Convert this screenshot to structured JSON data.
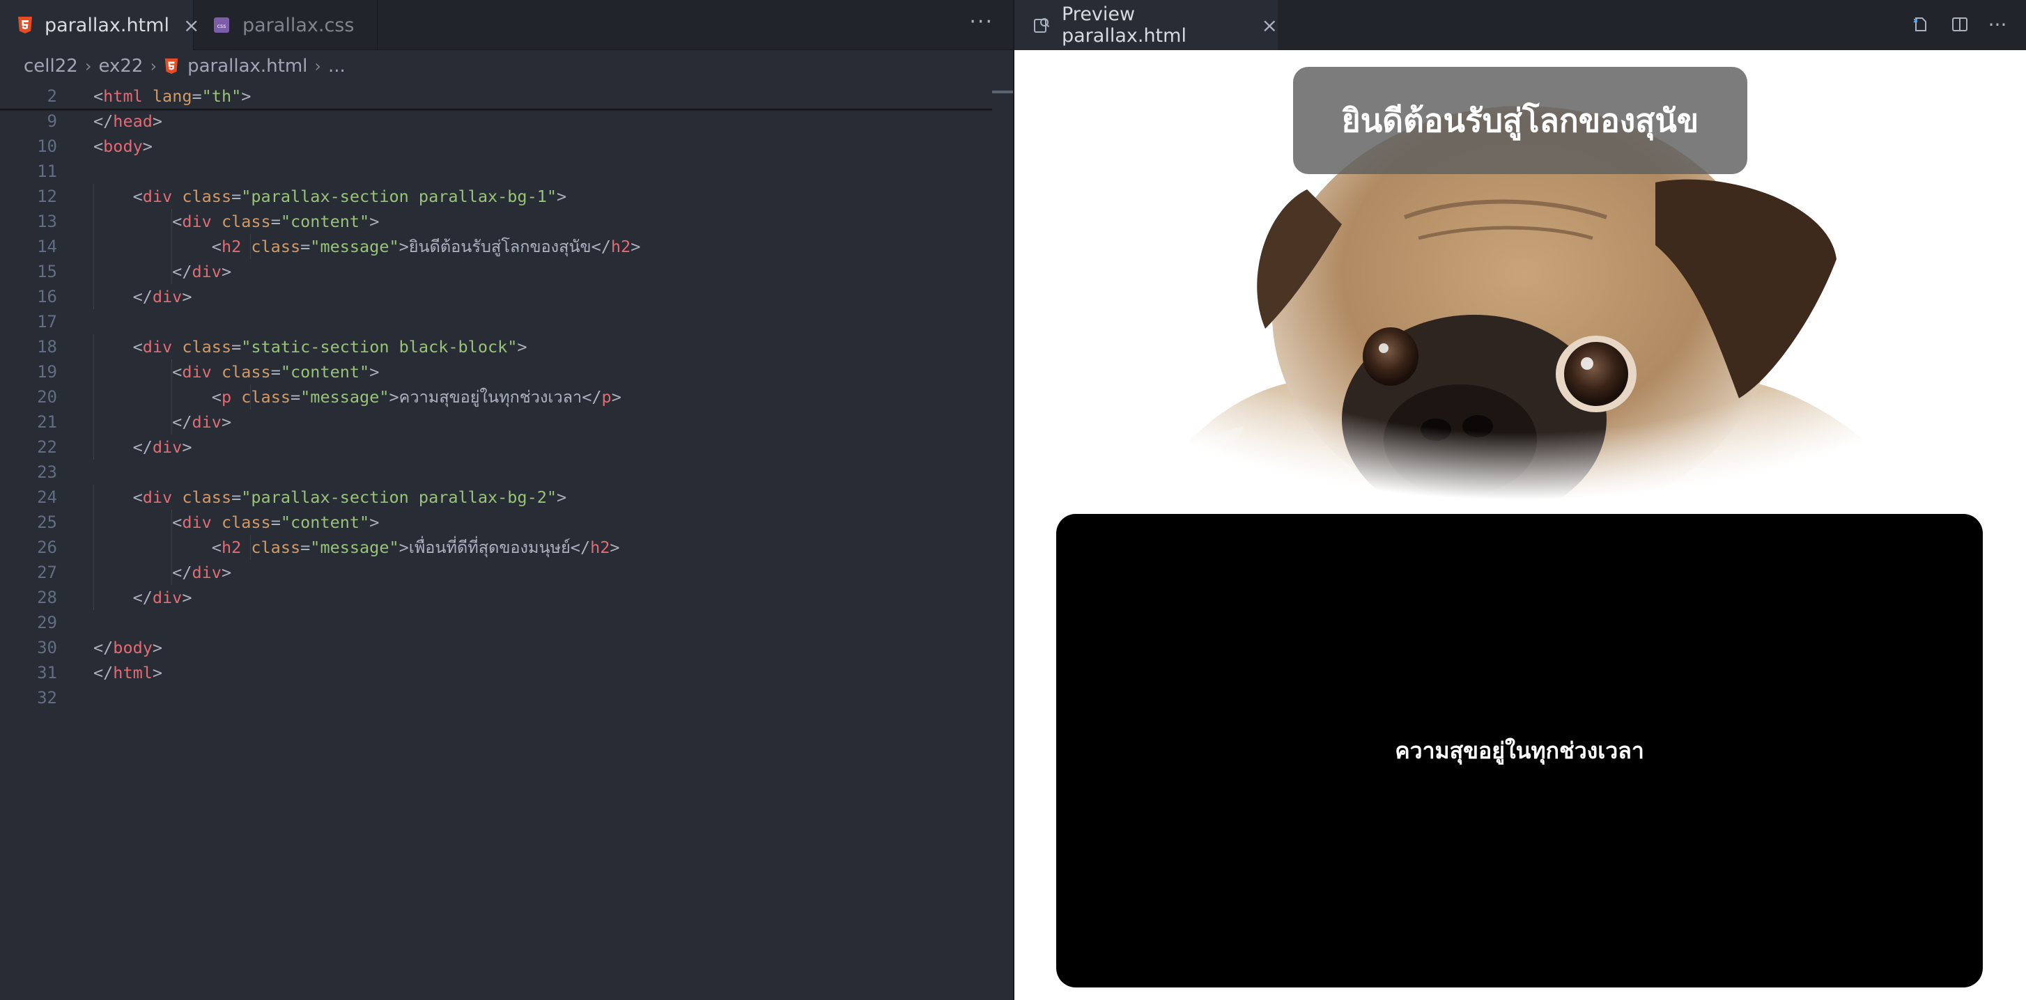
{
  "editor": {
    "tabs": [
      {
        "label": "parallax.html",
        "icon": "html5-file-icon",
        "active": true
      },
      {
        "label": "parallax.css",
        "icon": "css-file-icon",
        "active": false
      }
    ],
    "breadcrumb": {
      "items": [
        "cell22",
        "ex22",
        "parallax.html",
        "..."
      ]
    },
    "lines": [
      {
        "num": "2",
        "tokens": [
          [
            "p",
            "<"
          ],
          [
            "tag",
            "html"
          ],
          [
            "p",
            " "
          ],
          [
            "attr",
            "lang"
          ],
          [
            "p",
            "="
          ],
          [
            "str",
            "\"th\""
          ],
          [
            "p",
            ">"
          ]
        ]
      },
      {
        "num": "9",
        "tokens": [
          [
            "p",
            "</"
          ],
          [
            "tag",
            "head"
          ],
          [
            "p",
            ">"
          ]
        ]
      },
      {
        "num": "10",
        "tokens": [
          [
            "p",
            "<"
          ],
          [
            "tag",
            "body"
          ],
          [
            "p",
            ">"
          ]
        ]
      },
      {
        "num": "11",
        "tokens": []
      },
      {
        "num": "12",
        "tokens": [
          [
            "p",
            "    <"
          ],
          [
            "tag",
            "div"
          ],
          [
            "p",
            " "
          ],
          [
            "attr",
            "class"
          ],
          [
            "p",
            "="
          ],
          [
            "str",
            "\"parallax-section parallax-bg-1\""
          ],
          [
            "p",
            ">"
          ]
        ]
      },
      {
        "num": "13",
        "tokens": [
          [
            "p",
            "        <"
          ],
          [
            "tag",
            "div"
          ],
          [
            "p",
            " "
          ],
          [
            "attr",
            "class"
          ],
          [
            "p",
            "="
          ],
          [
            "str",
            "\"content\""
          ],
          [
            "p",
            ">"
          ]
        ]
      },
      {
        "num": "14",
        "tokens": [
          [
            "p",
            "            <"
          ],
          [
            "tag",
            "h2"
          ],
          [
            "p",
            " "
          ],
          [
            "attr",
            "class"
          ],
          [
            "p",
            "="
          ],
          [
            "str",
            "\"message\""
          ],
          [
            "p",
            ">ยินดีต้อนรับสู่โลกของสุนัข</"
          ],
          [
            "tag",
            "h2"
          ],
          [
            "p",
            ">"
          ]
        ]
      },
      {
        "num": "15",
        "tokens": [
          [
            "p",
            "        </"
          ],
          [
            "tag",
            "div"
          ],
          [
            "p",
            ">"
          ]
        ]
      },
      {
        "num": "16",
        "tokens": [
          [
            "p",
            "    </"
          ],
          [
            "tag",
            "div"
          ],
          [
            "p",
            ">"
          ]
        ]
      },
      {
        "num": "17",
        "tokens": []
      },
      {
        "num": "18",
        "tokens": [
          [
            "p",
            "    <"
          ],
          [
            "tag",
            "div"
          ],
          [
            "p",
            " "
          ],
          [
            "attr",
            "class"
          ],
          [
            "p",
            "="
          ],
          [
            "str",
            "\"static-section black-block\""
          ],
          [
            "p",
            ">"
          ]
        ]
      },
      {
        "num": "19",
        "tokens": [
          [
            "p",
            "        <"
          ],
          [
            "tag",
            "div"
          ],
          [
            "p",
            " "
          ],
          [
            "attr",
            "class"
          ],
          [
            "p",
            "="
          ],
          [
            "str",
            "\"content\""
          ],
          [
            "p",
            ">"
          ]
        ]
      },
      {
        "num": "20",
        "tokens": [
          [
            "p",
            "            <"
          ],
          [
            "tag",
            "p"
          ],
          [
            "p",
            " "
          ],
          [
            "attr",
            "class"
          ],
          [
            "p",
            "="
          ],
          [
            "str",
            "\"message\""
          ],
          [
            "p",
            ">ความสุขอยู่ในทุกช่วงเวลา</"
          ],
          [
            "tag",
            "p"
          ],
          [
            "p",
            ">"
          ]
        ]
      },
      {
        "num": "21",
        "tokens": [
          [
            "p",
            "        </"
          ],
          [
            "tag",
            "div"
          ],
          [
            "p",
            ">"
          ]
        ]
      },
      {
        "num": "22",
        "tokens": [
          [
            "p",
            "    </"
          ],
          [
            "tag",
            "div"
          ],
          [
            "p",
            ">"
          ]
        ]
      },
      {
        "num": "23",
        "tokens": []
      },
      {
        "num": "24",
        "tokens": [
          [
            "p",
            "    <"
          ],
          [
            "tag",
            "div"
          ],
          [
            "p",
            " "
          ],
          [
            "attr",
            "class"
          ],
          [
            "p",
            "="
          ],
          [
            "str",
            "\"parallax-section parallax-bg-2\""
          ],
          [
            "p",
            ">"
          ]
        ]
      },
      {
        "num": "25",
        "tokens": [
          [
            "p",
            "        <"
          ],
          [
            "tag",
            "div"
          ],
          [
            "p",
            " "
          ],
          [
            "attr",
            "class"
          ],
          [
            "p",
            "="
          ],
          [
            "str",
            "\"content\""
          ],
          [
            "p",
            ">"
          ]
        ]
      },
      {
        "num": "26",
        "tokens": [
          [
            "p",
            "            <"
          ],
          [
            "tag",
            "h2"
          ],
          [
            "p",
            " "
          ],
          [
            "attr",
            "class"
          ],
          [
            "p",
            "="
          ],
          [
            "str",
            "\"message\""
          ],
          [
            "p",
            ">เพื่อนที่ดีที่สุดของมนุษย์</"
          ],
          [
            "tag",
            "h2"
          ],
          [
            "p",
            ">"
          ]
        ]
      },
      {
        "num": "27",
        "tokens": [
          [
            "p",
            "        </"
          ],
          [
            "tag",
            "div"
          ],
          [
            "p",
            ">"
          ]
        ]
      },
      {
        "num": "28",
        "tokens": [
          [
            "p",
            "    </"
          ],
          [
            "tag",
            "div"
          ],
          [
            "p",
            ">"
          ]
        ]
      },
      {
        "num": "29",
        "tokens": []
      },
      {
        "num": "30",
        "tokens": [
          [
            "p",
            "</"
          ],
          [
            "tag",
            "body"
          ],
          [
            "p",
            ">"
          ]
        ]
      },
      {
        "num": "31",
        "tokens": [
          [
            "p",
            "</"
          ],
          [
            "tag",
            "html"
          ],
          [
            "p",
            ">"
          ]
        ]
      },
      {
        "num": "32",
        "tokens": []
      }
    ]
  },
  "preview": {
    "tab_label": "Preview parallax.html",
    "title_message": "ยินดีต้อนรับสู่โลกของสุนัข",
    "block_message": "ความสุขอยู่ในทุกช่วงเวลา",
    "hero_image": "pug-photo"
  },
  "colors": {
    "editor_bg": "#282c34",
    "tabbar_bg": "#21252b",
    "tag": "#e06c75",
    "attr": "#d19a66",
    "string": "#98c379",
    "html_icon": "#e44d26",
    "css_icon": "#7b5ea7"
  }
}
